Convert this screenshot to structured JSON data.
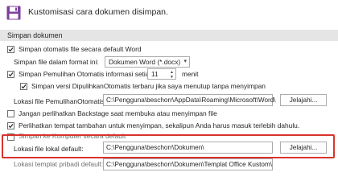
{
  "header": {
    "title": "Kustomisasi cara dokumen disimpan."
  },
  "section": {
    "title": "Simpan dokumen"
  },
  "autosave": {
    "label": "Simpan otomatis file secara default Word"
  },
  "format": {
    "label": "Simpan file dalam format ini:",
    "value": "Dokumen Word (*.docx)"
  },
  "autorecover": {
    "label": "Simpan Pemulihan Otomatis informasi setiap",
    "minutes": "11",
    "unit": "menit"
  },
  "keeplast": {
    "label": "Simpan versi DipulihkanOtomatis terbaru jika saya menutup tanpa menyimpan"
  },
  "autorecover_location": {
    "label": "Lokasi file PemulihanOtomatis:",
    "path": "C:\\Pengguna\\beschorr\\AppData\\Roaming\\Microsoft\\Word\\",
    "button": "Jelajahi..."
  },
  "backstage": {
    "label": "Jangan perlihatkan Backstage saat membuka atau menyimpan file"
  },
  "additional_places": {
    "label": "Perlihatkan tempat tambahan untuk menyimpan, sekalipun Anda harus masuk terlebih dahulu."
  },
  "save_to_computer": {
    "label": "Simpan ke Komputer secara default"
  },
  "local_default": {
    "label": "Lokasi file lokal default:",
    "path": "C:\\Pengguna\\beschorr\\Dokumen\\",
    "button": "Jelajahi..."
  },
  "template_location": {
    "label": "Lokasi templat pribadi default:",
    "path": "C:\\Pengguna\\beschorr\\Dokumen\\Templat Office Kustom\\"
  },
  "colors": {
    "highlight": "#d9342b",
    "section_bg": "#e5e5e5",
    "icon": "#7b3f9e"
  }
}
